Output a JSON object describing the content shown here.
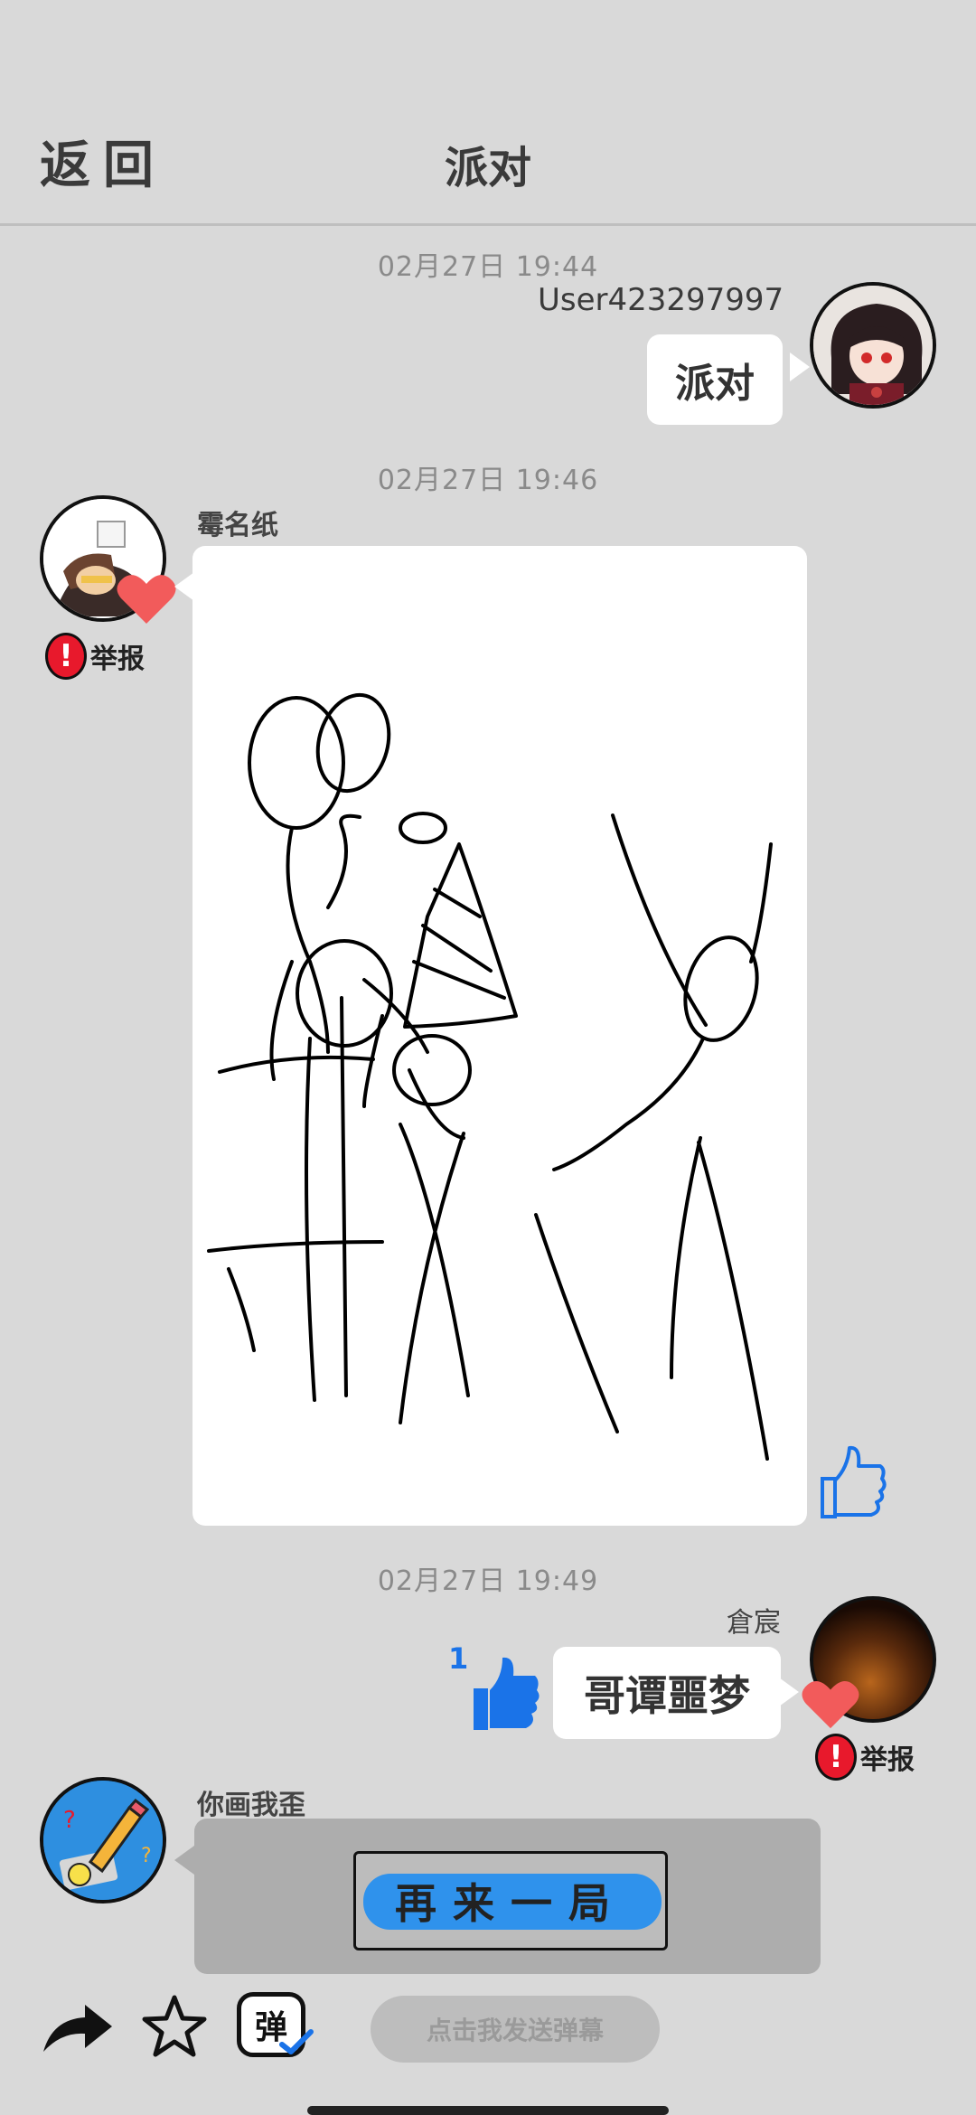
{
  "header": {
    "back_label": "返回",
    "title": "派对"
  },
  "messages": [
    {
      "timestamp": "02月27日  19:44",
      "username": "User423297997",
      "text": "派对"
    },
    {
      "timestamp": "02月27日  19:46",
      "username": "霉名纸",
      "report_label": "举报",
      "content": "drawing"
    },
    {
      "timestamp": "02月27日  19:49",
      "username": "倉宸",
      "text": "哥谭噩梦",
      "like_count": "1",
      "report_label": "举报"
    }
  ],
  "game": {
    "name": "你画我歪",
    "button_label": "再来一局"
  },
  "bottom_bar": {
    "danmaku_badge": "弹",
    "danmaku_placeholder": "点击我发送弹幕"
  },
  "colors": {
    "background": "#d9d9d9",
    "like_blue": "#1a73e8",
    "heart_red": "#f25b5b",
    "report_red": "#e8192c"
  }
}
